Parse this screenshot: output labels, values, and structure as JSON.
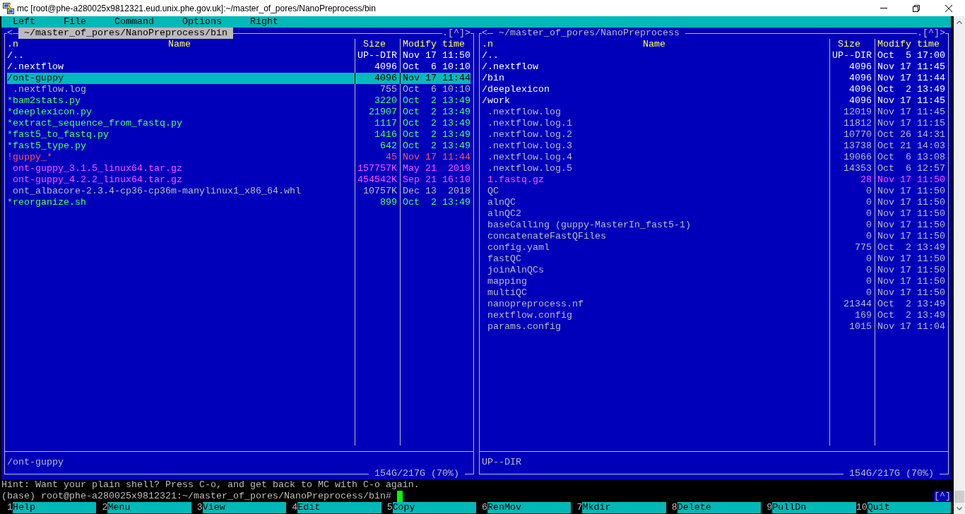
{
  "window": {
    "title": "mc [root@phe-a280025x9812321.eud.unix.phe.gov.uk]:~/master_of_pores/NanoPreprocess/bin"
  },
  "menu_bar": [
    "Left",
    "File",
    "Command",
    "Options",
    "Right"
  ],
  "panels": [
    {
      "active": true,
      "back_button": "<",
      "path": "~/master_of_pores/NanoPreprocess/bin",
      "controls": ".[^]>",
      "sort_mark": ".n",
      "columns": [
        "Name",
        "Size",
        "Modify time"
      ],
      "files": [
        {
          "name": "/..",
          "size": "UP--DIR",
          "time": "Nov 17 11:50",
          "kind": "dir",
          "selected": false
        },
        {
          "name": "/.nextflow",
          "size": "4096",
          "time": "Oct  6 10:10",
          "kind": "dir",
          "selected": false
        },
        {
          "name": "/ont-guppy",
          "size": "4096",
          "time": "Nov 17 11:44",
          "kind": "dir",
          "selected": true
        },
        {
          "name": ".nextflow.log",
          "size": "755",
          "time": "Oct  6 10:10",
          "kind": "file",
          "selected": false
        },
        {
          "name": "*bam2stats.py",
          "size": "3220",
          "time": "Oct  2 13:49",
          "kind": "exec",
          "selected": false
        },
        {
          "name": "*deeplexicon.py",
          "size": "21907",
          "time": "Oct  2 13:49",
          "kind": "exec",
          "selected": false
        },
        {
          "name": "*extract_sequence_from_fastq.py",
          "size": "1117",
          "time": "Oct  2 13:49",
          "kind": "exec",
          "selected": false
        },
        {
          "name": "*fast5_to_fastq.py",
          "size": "1416",
          "time": "Oct  2 13:49",
          "kind": "exec",
          "selected": false
        },
        {
          "name": "*fast5_type.py",
          "size": "642",
          "time": "Oct  2 13:49",
          "kind": "exec",
          "selected": false
        },
        {
          "name": "!guppy_*",
          "size": "45",
          "time": "Nov 17 11:44",
          "kind": "broken",
          "selected": false
        },
        {
          "name": "ont-guppy_3.1.5_linux64.tar.gz",
          "size": "157757K",
          "time": "May 21  2019",
          "kind": "archive",
          "selected": false
        },
        {
          "name": "ont-guppy_4.2.2_linux64.tar.gz",
          "size": "454542K",
          "time": "Sep 21 16:10",
          "kind": "archive",
          "selected": false
        },
        {
          "name": "ont_albacore-2.3.4-cp36-cp36m-manylinux1_x86_64.whl",
          "size": "10757K",
          "time": "Dec 13  2018",
          "kind": "file",
          "selected": false
        },
        {
          "name": "*reorganize.sh",
          "size": "899",
          "time": "Oct  2 13:49",
          "kind": "exec",
          "selected": false
        }
      ],
      "mini_status": "/ont-guppy",
      "disk_usage": "154G/217G (70%)"
    },
    {
      "active": false,
      "back_button": "<",
      "path": "~/master_of_pores/NanoPreprocess",
      "controls": ".[^]>",
      "sort_mark": ".n",
      "columns": [
        "Name",
        "Size",
        "Modify time"
      ],
      "files": [
        {
          "name": "/..",
          "size": "UP--DIR",
          "time": "Oct  5 17:00",
          "kind": "dir",
          "selected": false
        },
        {
          "name": "/.nextflow",
          "size": "4096",
          "time": "Nov 17 11:45",
          "kind": "dir",
          "selected": false
        },
        {
          "name": "/bin",
          "size": "4096",
          "time": "Nov 17 11:44",
          "kind": "dir",
          "selected": false
        },
        {
          "name": "/deeplexicon",
          "size": "4096",
          "time": "Oct  2 13:49",
          "kind": "dir",
          "selected": false
        },
        {
          "name": "/work",
          "size": "4096",
          "time": "Nov 17 11:45",
          "kind": "dir",
          "selected": false
        },
        {
          "name": ".nextflow.log",
          "size": "12019",
          "time": "Nov 17 11:45",
          "kind": "file",
          "selected": false
        },
        {
          "name": ".nextflow.log.1",
          "size": "11812",
          "time": "Nov 17 11:15",
          "kind": "file",
          "selected": false
        },
        {
          "name": ".nextflow.log.2",
          "size": "10770",
          "time": "Oct 26 14:31",
          "kind": "file",
          "selected": false
        },
        {
          "name": ".nextflow.log.3",
          "size": "13738",
          "time": "Oct 21 14:03",
          "kind": "file",
          "selected": false
        },
        {
          "name": ".nextflow.log.4",
          "size": "19066",
          "time": "Oct  6 13:08",
          "kind": "file",
          "selected": false
        },
        {
          "name": ".nextflow.log.5",
          "size": "14353",
          "time": "Oct  6 12:57",
          "kind": "file",
          "selected": false
        },
        {
          "name": "1.fastq.gz",
          "size": "28",
          "time": "Nov 17 11:50",
          "kind": "archive",
          "selected": false
        },
        {
          "name": "QC",
          "size": "0",
          "time": "Nov 17 11:50",
          "kind": "file",
          "selected": false
        },
        {
          "name": "alnQC",
          "size": "0",
          "time": "Nov 17 11:50",
          "kind": "file",
          "selected": false
        },
        {
          "name": "alnQC2",
          "size": "0",
          "time": "Nov 17 11:50",
          "kind": "file",
          "selected": false
        },
        {
          "name": "baseCalling (guppy-MasterIn_fast5-1)",
          "size": "0",
          "time": "Nov 17 11:50",
          "kind": "file",
          "selected": false
        },
        {
          "name": "concatenateFastQFiles",
          "size": "0",
          "time": "Nov 17 11:50",
          "kind": "file",
          "selected": false
        },
        {
          "name": "config.yaml",
          "size": "775",
          "time": "Oct  2 13:49",
          "kind": "file",
          "selected": false
        },
        {
          "name": "fastQC",
          "size": "0",
          "time": "Nov 17 11:50",
          "kind": "file",
          "selected": false
        },
        {
          "name": "joinAlnQCs",
          "size": "0",
          "time": "Nov 17 11:50",
          "kind": "file",
          "selected": false
        },
        {
          "name": "mapping",
          "size": "0",
          "time": "Nov 17 11:50",
          "kind": "file",
          "selected": false
        },
        {
          "name": "multiQC",
          "size": "0",
          "time": "Nov 17 11:50",
          "kind": "file",
          "selected": false
        },
        {
          "name": "nanopreprocess.nf",
          "size": "21344",
          "time": "Oct  2 13:49",
          "kind": "file",
          "selected": false
        },
        {
          "name": "nextflow.config",
          "size": "169",
          "time": "Oct  2 13:49",
          "kind": "file",
          "selected": false
        },
        {
          "name": "params.config",
          "size": "1015",
          "time": "Nov 17 11:04",
          "kind": "file",
          "selected": false
        }
      ],
      "mini_status": "UP--DIR",
      "disk_usage": "154G/217G (70%)"
    }
  ],
  "hint": "Hint: Want your plain shell? Press C-o, and get back to MC with C-o again.",
  "command_line": {
    "prompt": "(base) root@phe-a280025x9812321:~/master_of_pores/NanoPreprocess/bin#",
    "history_button": "[^]"
  },
  "function_keys": [
    {
      "number": "1",
      "label": "Help"
    },
    {
      "number": "2",
      "label": "Menu"
    },
    {
      "number": "3",
      "label": "View"
    },
    {
      "number": "4",
      "label": "Edit"
    },
    {
      "number": "5",
      "label": "Copy"
    },
    {
      "number": "6",
      "label": "RenMov"
    },
    {
      "number": "7",
      "label": "Mkdir"
    },
    {
      "number": "8",
      "label": "Delete"
    },
    {
      "number": "9",
      "label": "PullDn"
    },
    {
      "number": "10",
      "label": "Quit"
    }
  ]
}
